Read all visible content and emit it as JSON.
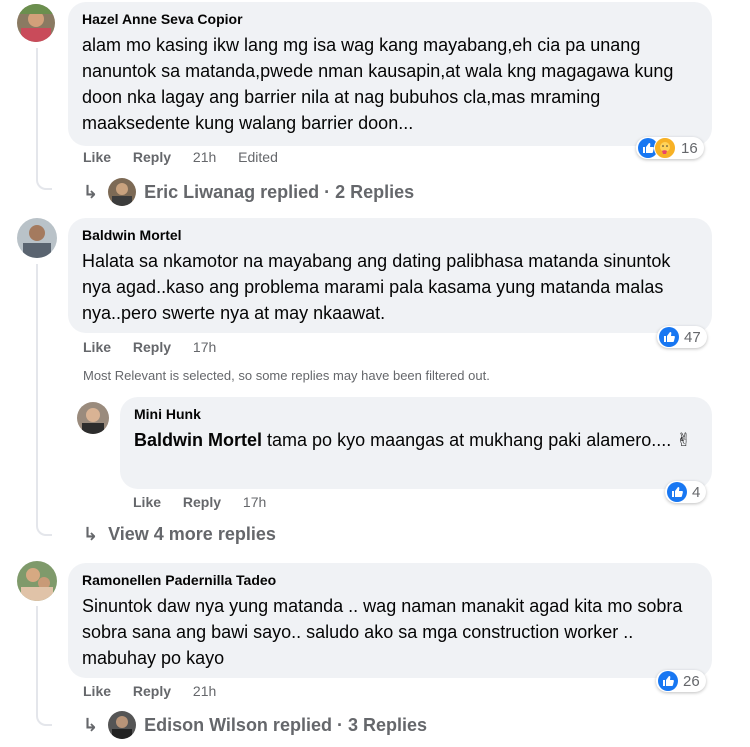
{
  "comments": [
    {
      "author": "Hazel Anne Seva Copior",
      "text": "alam mo kasing ikw lang mg isa wag kang mayabang,eh cia pa unang nanuntok sa matanda,pwede nman kausapin,at wala kng magagawa kung doon nka lagay ang barrier nila at nag bubuhos cla,mas mraming maaksedente kung walang barrier doon...",
      "like": "Like",
      "reply": "Reply",
      "time": "21h",
      "edited": "Edited",
      "reactions": "16",
      "replies_text": "Eric Liwanag replied · 2 Replies"
    },
    {
      "author": "Baldwin Mortel",
      "text": "Halata sa nkamotor na mayabang ang dating palibhasa matanda sinuntok nya agad..kaso ang problema marami pala kasama yung matanda malas nya..pero swerte nya at may nkaawat.",
      "like": "Like",
      "reply": "Reply",
      "time": "17h",
      "reactions": "47",
      "filter_note": "Most Relevant is selected, so some replies may have been filtered out.",
      "nested_reply": {
        "author": "Mini Hunk",
        "mention": "Baldwin Mortel",
        "text": "tama po kyo maangas at mukhang paki alamero.... ✌",
        "like": "Like",
        "reply": "Reply",
        "time": "17h",
        "reactions": "4"
      },
      "view_more": "View 4 more replies"
    },
    {
      "author": "Ramonellen Padernilla Tadeo",
      "text": "Sinuntok daw nya yung matanda .. wag naman manakit agad kita mo sobra sobra sana ang bawi sayo.. saludo ako sa mga construction worker .. mabuhay po kayo",
      "like": "Like",
      "reply": "Reply",
      "time": "21h",
      "reactions": "26",
      "replies_text": "Edison Wilson replied · 3 Replies"
    }
  ],
  "colors": {
    "bubble": "#f0f2f5",
    "muted": "#65676b",
    "like_blue": "#1877f2",
    "care_yellow": "#f7b125"
  },
  "icons": [
    "like-reaction-icon",
    "care-reaction-icon",
    "reply-arrow-icon",
    "victory-hand-emoji"
  ]
}
